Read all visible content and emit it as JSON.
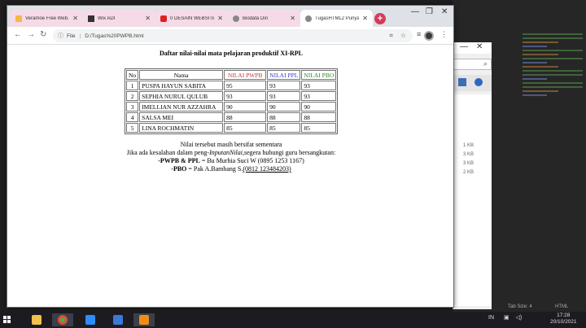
{
  "browser": {
    "tabs": [
      {
        "title": "Veramoe Free Web...",
        "fav_color": "#f2b84b",
        "active": false
      },
      {
        "title": "Wix ADI",
        "fav_color": "#333333",
        "active": false
      },
      {
        "title": "0 DESAIN WEBSITE",
        "fav_color": "#e02020",
        "active": false
      },
      {
        "title": "Biodata Diri",
        "fav_color": "#888888",
        "active": false
      },
      {
        "title": "TugasHTML2 Punya...",
        "fav_color": "#888888",
        "active": true
      }
    ],
    "address": {
      "scheme_label": "File",
      "url": "D:/Tugas%20PWPB.html"
    }
  },
  "page": {
    "title": "Daftar nilai-nilai mata pelajaran produktif XI-RPL",
    "table": {
      "headers": [
        "No",
        "Nama",
        "NILAI PWPB",
        "NILAI PPL",
        "NILAI PBO"
      ],
      "header_colors": {
        "pwpb": "#c23a3a",
        "ppl": "#3c3cc8",
        "pbo": "#2a8a2a"
      },
      "rows": [
        {
          "no": "1",
          "nama": "PUSPA HAYUN SABITA",
          "pwpb": "95",
          "ppl": "93",
          "pbo": "93"
        },
        {
          "no": "2",
          "nama": "SEPHIA NURUL QULUB",
          "pwpb": "93",
          "ppl": "93",
          "pbo": "93"
        },
        {
          "no": "3",
          "nama": "IMELLIAN NUR AZZAHRA",
          "pwpb": "90",
          "ppl": "90",
          "pbo": "90"
        },
        {
          "no": "4",
          "nama": "SALSA MEI",
          "pwpb": "88",
          "ppl": "88",
          "pbo": "88"
        },
        {
          "no": "5",
          "nama": "LINA ROCHMATIN",
          "pwpb": "85",
          "ppl": "85",
          "pbo": "85"
        }
      ]
    },
    "notes": {
      "line1": "Nilai tersebut masih bersifat sementara",
      "line2_pre": "Jika ada kesalahan dalam peng-",
      "line2_italic": "InputanNilai",
      "line2_post": ",segera hubungi guru bersangkutan:",
      "pwpb_label": "-PWPB & PPL",
      "pwpb_contact": " = Bu Murhia Suci W (0895 1253 1167)",
      "pbo_label": "-PBO",
      "pbo_contact": " = Pak A.Bambang S.",
      "pbo_phone": "(0812 123484203)"
    }
  },
  "background": {
    "explorer_sizes": [
      "1 KB",
      "3 KB",
      "3 KB",
      "2 KB"
    ],
    "status_tab_size": "Tab Size: 4",
    "status_lang": "HTML"
  },
  "taskbar": {
    "apps": [
      {
        "name": "file-explorer",
        "color": "#f2c14e"
      },
      {
        "name": "chrome",
        "color": "#4caf50"
      },
      {
        "name": "zoom",
        "color": "#2d8cff"
      },
      {
        "name": "app-blue",
        "color": "#3b78d8"
      },
      {
        "name": "sublime",
        "color": "#f08c1a"
      }
    ],
    "lang": "IN",
    "time": "17:28",
    "date": "20/10/2021"
  }
}
